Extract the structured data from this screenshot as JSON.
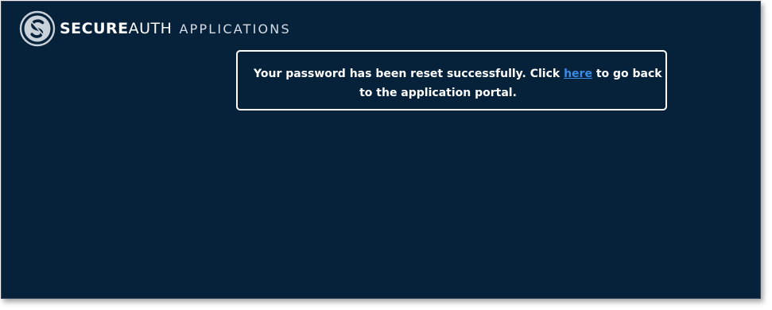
{
  "brand": {
    "name_bold": "SECURE",
    "name_regular": "AUTH",
    "section": "APPLICATIONS",
    "logo_icon": "secureauth-logo-icon"
  },
  "message": {
    "text_before_link": "Your password has been reset successfully. Click ",
    "link_text": "here",
    "text_after_link": " to go back",
    "text_line2": "to the application portal."
  },
  "colors": {
    "background": "#06213a",
    "text": "#ffffff",
    "link": "#3b8be8",
    "box_border": "#ffffff"
  }
}
